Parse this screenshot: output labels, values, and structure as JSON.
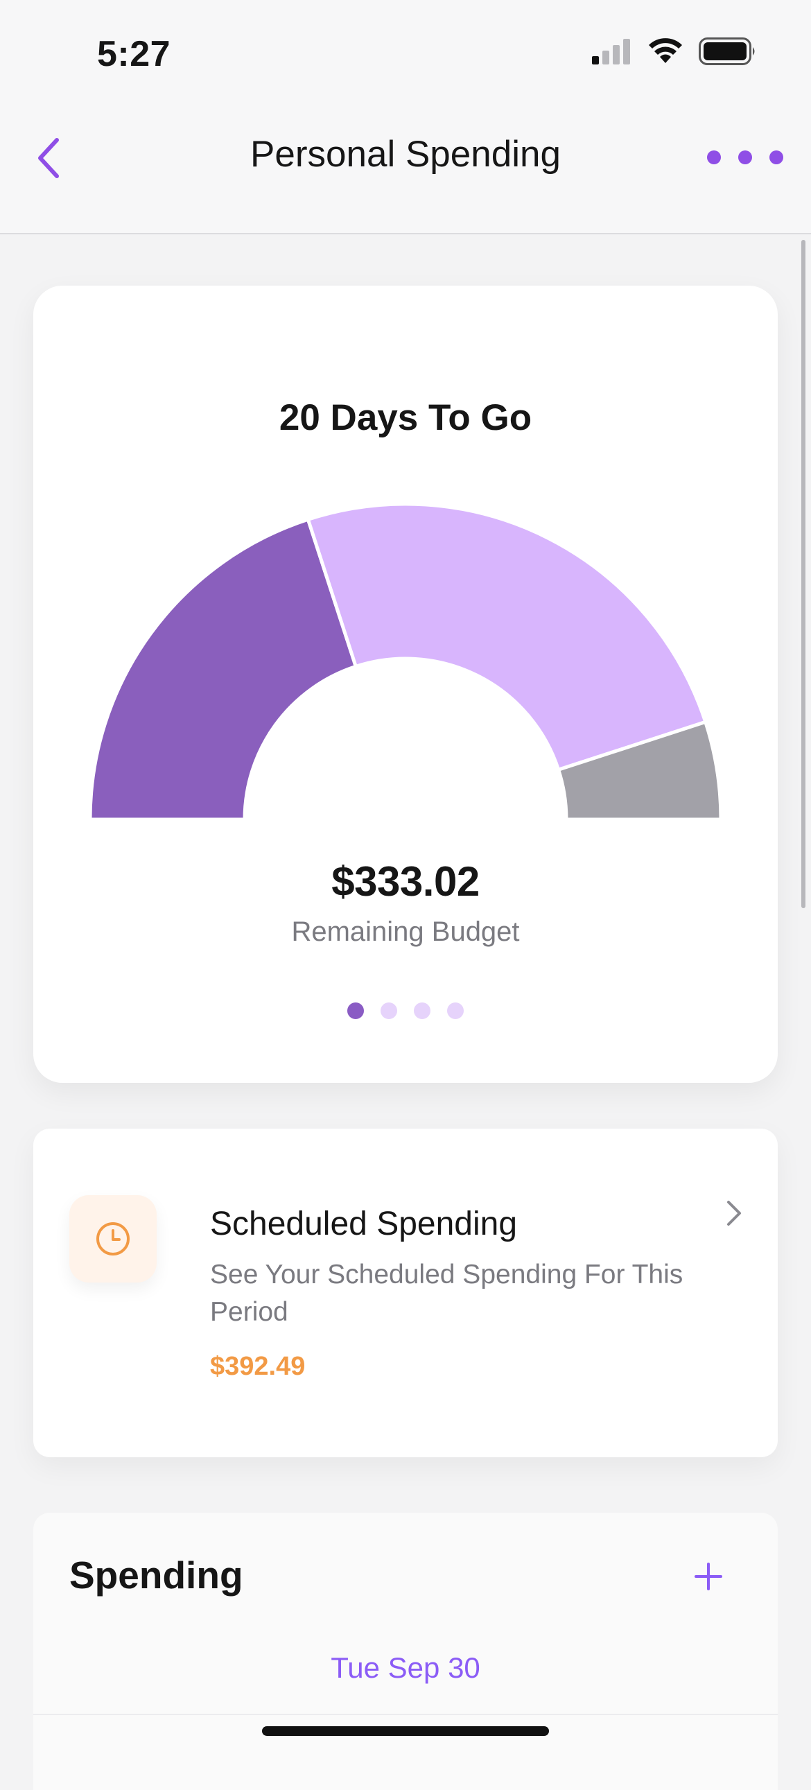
{
  "status_bar": {
    "time": "5:27",
    "icons": [
      "cellular-signal-icon",
      "wifi-icon",
      "battery-icon"
    ]
  },
  "nav": {
    "title": "Personal Spending",
    "back_icon": "chevron-left-icon",
    "more_icon": "ellipsis-icon",
    "accent_color": "#8f4ee6"
  },
  "budget": {
    "heading": "20 Days To Go",
    "amount": "$333.02",
    "label": "Remaining Budget",
    "page_count": 4,
    "active_page": 0,
    "colors": {
      "spent": "#8a5fbd",
      "scheduled": "#d8b5fd",
      "remaining": "#a2a1a8"
    }
  },
  "chart_data": {
    "type": "pie",
    "subtype": "semicircle-gauge",
    "title": "20 Days To Go",
    "slices": [
      {
        "fraction": 0.4,
        "color": "#8a5fbd"
      },
      {
        "fraction": 0.5,
        "color": "#d8b5fd"
      },
      {
        "fraction": 0.1,
        "color": "#a2a1a8"
      }
    ]
  },
  "scheduled": {
    "icon": "clock-icon",
    "title": "Scheduled Spending",
    "description": "See Your Scheduled Spending For This Period",
    "amount": "$392.49",
    "amount_color": "#f29a45",
    "chevron_icon": "chevron-right-icon"
  },
  "spending": {
    "title": "Spending",
    "add_icon": "plus-icon",
    "date": "Tue Sep 30"
  }
}
